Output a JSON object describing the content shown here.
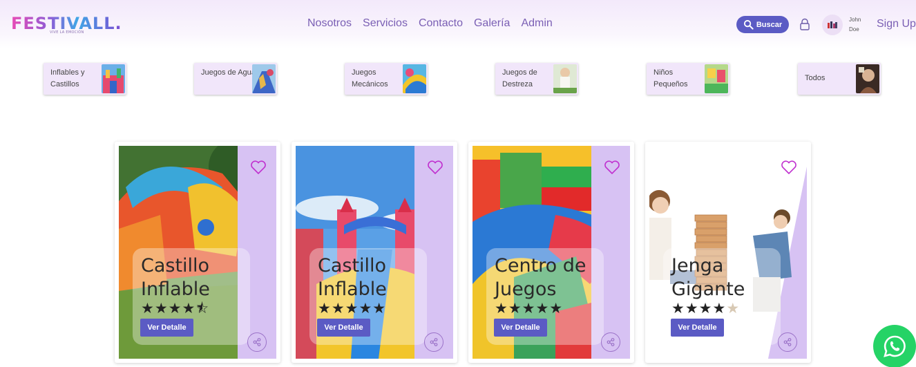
{
  "header": {
    "logo_text": "FESTIVALL.",
    "logo_tagline": "VIVE LA EMOCIÓN",
    "nav": [
      "Nosotros",
      "Servicios",
      "Contacto",
      "Galería",
      "Admin"
    ],
    "search_label": "Buscar",
    "user": {
      "first": "John",
      "last": "Doe"
    },
    "signup": "Sign Up"
  },
  "categories": [
    {
      "label": "Inflables y Castillos"
    },
    {
      "label": "Juegos de Agua"
    },
    {
      "label": "Juegos Mecánicos"
    },
    {
      "label": "Juegos de Destreza"
    },
    {
      "label": "Niños Pequeños"
    },
    {
      "label": "Todos"
    }
  ],
  "products": [
    {
      "title": "Castillo Inflable",
      "rating": 4.5,
      "button": "Ver Detalle"
    },
    {
      "title": "Castillo Inflable",
      "rating": 5,
      "button": "Ver Detalle"
    },
    {
      "title": "Centro de Juegos",
      "rating": 5,
      "button": "Ver Detalle"
    },
    {
      "title": "Jenga Gigante",
      "rating": 4,
      "button": "Ver Detalle"
    }
  ],
  "colors": {
    "accent": "#5b5bc4",
    "nav": "#7a5fb4",
    "heart": "#c02fcf",
    "whatsapp": "#25d366"
  },
  "icons": [
    "search-icon",
    "lock-icon",
    "heart-icon",
    "share-icon",
    "whatsapp-icon"
  ]
}
